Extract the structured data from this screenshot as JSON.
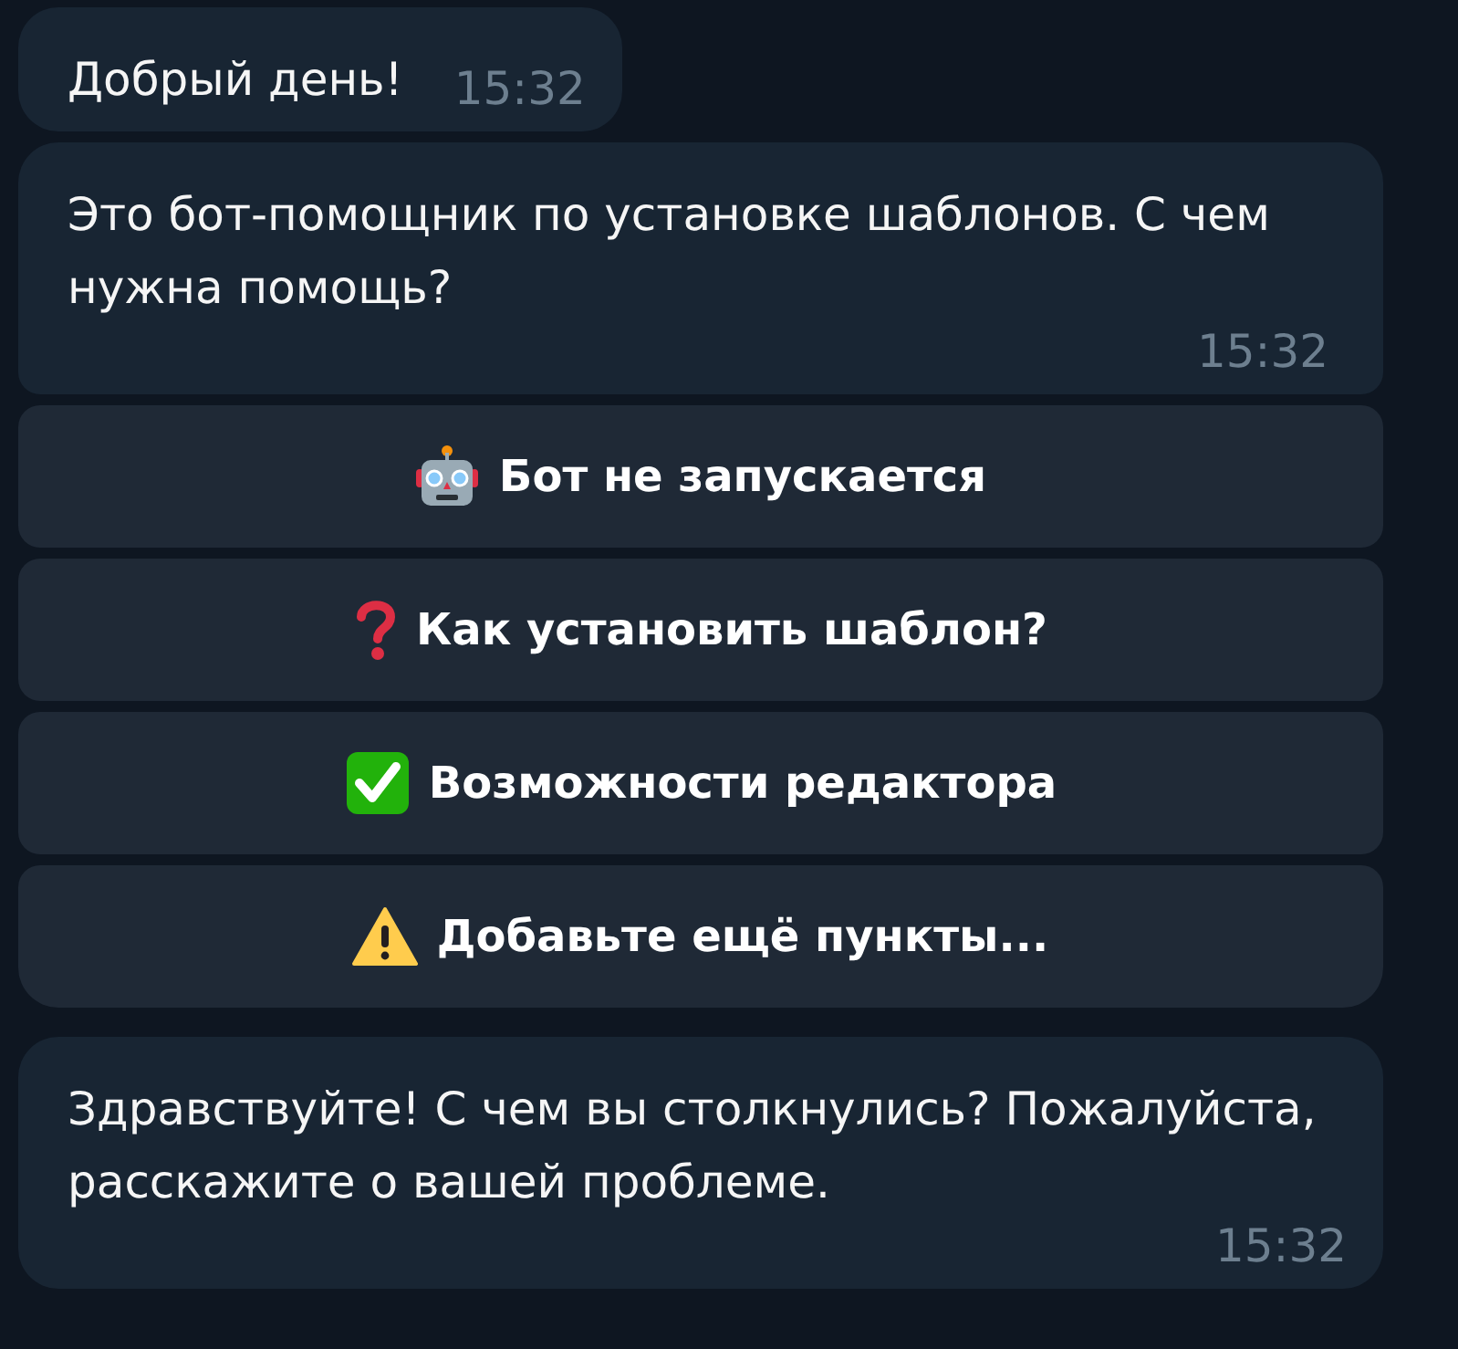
{
  "messages": [
    {
      "text": "Добрый день!",
      "time": "15:32"
    },
    {
      "text": "Это бот-помощник по установке шаблонов. С чем нужна помощь?",
      "time": "15:32",
      "buttons": [
        {
          "kind": "robot",
          "label": "Бот не запускается"
        },
        {
          "kind": "question",
          "label": "Как установить шаблон?"
        },
        {
          "kind": "check",
          "label": "Возможности редактора"
        },
        {
          "kind": "warning",
          "label": "Добавьте ещё пункты..."
        }
      ]
    },
    {
      "text": "Здравствуйте! С чем вы столкнулись? Пожалуйста, расскажите о вашей проблеме.",
      "time": "15:32"
    }
  ]
}
